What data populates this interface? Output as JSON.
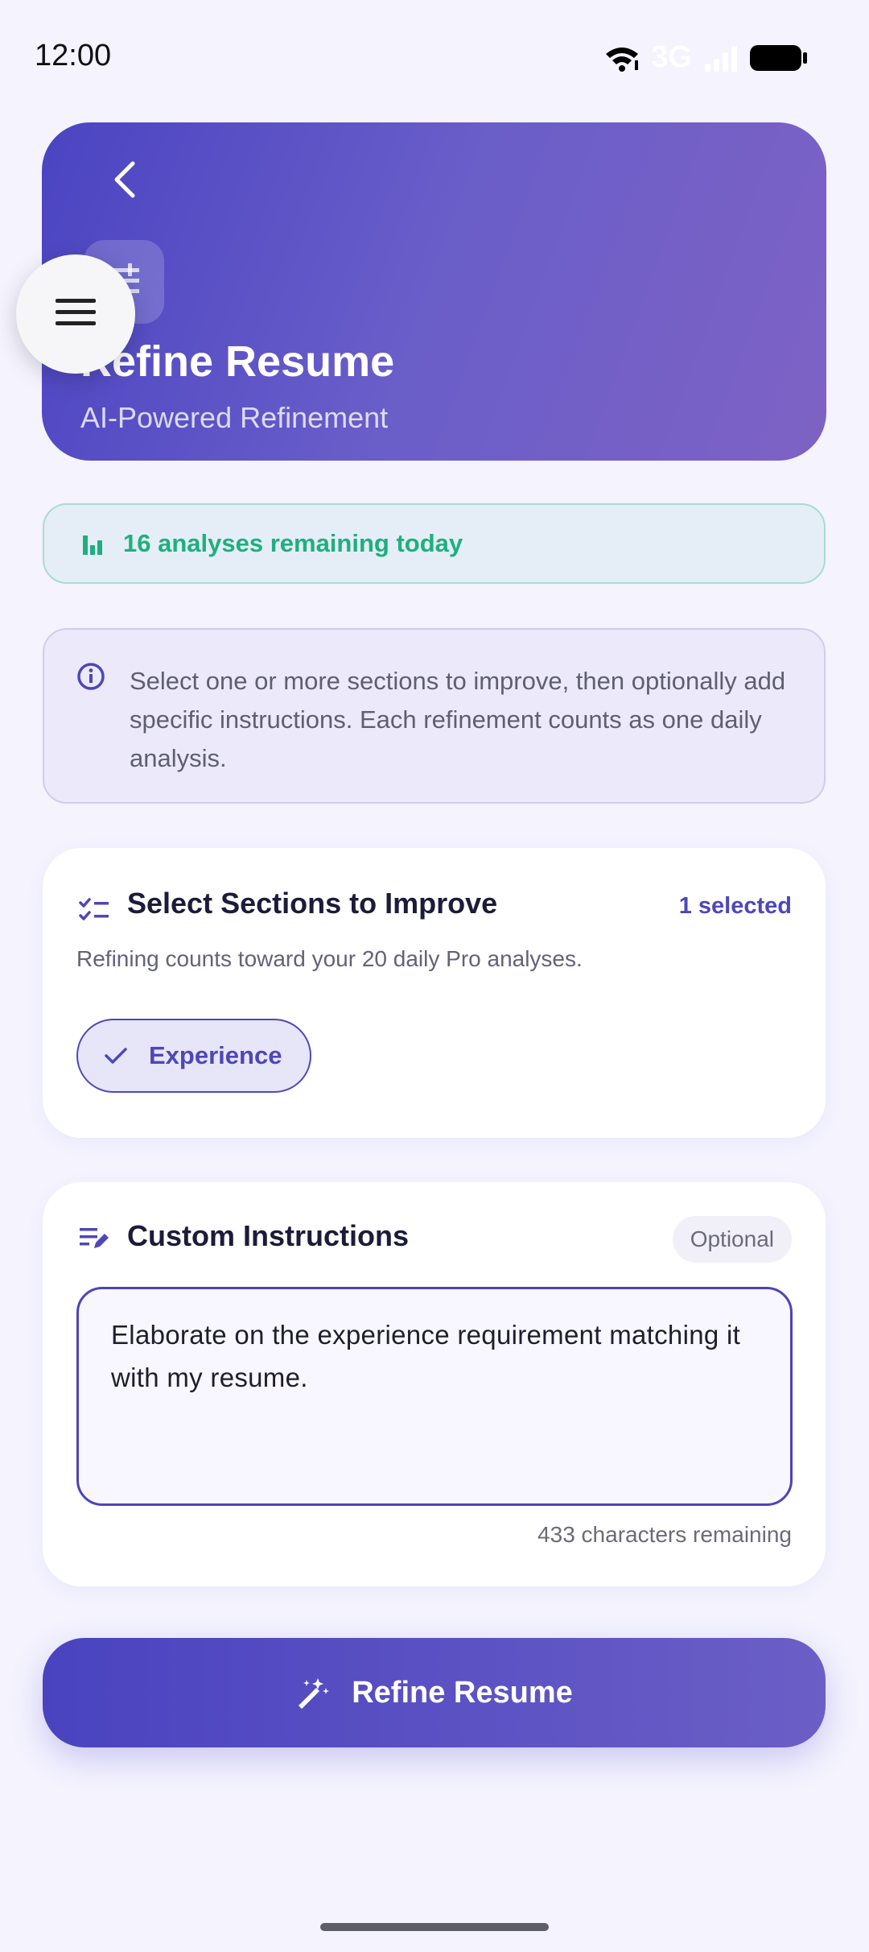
{
  "status_bar": {
    "time": "12:00",
    "network": "3G",
    "icons": [
      "wifi-icon",
      "signal-icon",
      "battery-icon"
    ]
  },
  "header": {
    "title": "Refine Resume",
    "subtitle": "AI-Powered Refinement",
    "back_icon": "chevron-left-icon",
    "badge_icon": "tune-icon",
    "gradient_start": "#4B44C2",
    "gradient_end": "#7E62C4"
  },
  "menu": {
    "icon": "hamburger-menu-icon"
  },
  "quota": {
    "text": "16 analyses remaining today",
    "icon": "bar-chart-icon",
    "color": "#1FAF7F"
  },
  "info": {
    "icon": "info-icon",
    "text": "Select one or more sections to improve, then optionally add specific instructions. Each refinement counts as one daily analysis."
  },
  "sections": {
    "icon": "checklist-icon",
    "title": "Select Sections to Improve",
    "selected_count": "1 selected",
    "note": "Refining counts toward your 20 daily Pro analyses.",
    "chips": [
      {
        "label": "Experience",
        "selected": true,
        "icon": "check-icon"
      }
    ]
  },
  "instructions": {
    "icon": "edit-note-icon",
    "title": "Custom Instructions",
    "optional_label": "Optional",
    "value": "Elaborate on the experience requirement matching it with my resume.",
    "chars_remaining": "433 characters remaining"
  },
  "primary_action": {
    "label": "Refine Resume",
    "icon": "magic-wand-icon",
    "color": "#4A43C0"
  }
}
